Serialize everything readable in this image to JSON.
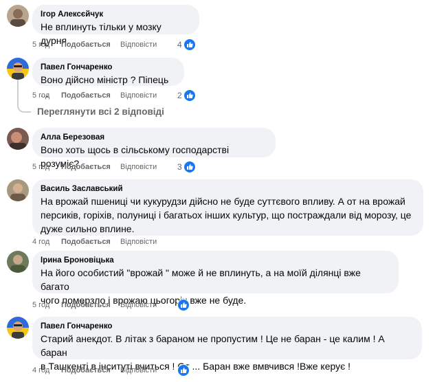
{
  "comments": [
    {
      "author": "Ігор Алексєйчук",
      "text": [
        "Не вплинуть тільки у мозку дурня."
      ],
      "time": "5 год",
      "like": "Подобається",
      "reply": "Відповісти",
      "reactions": "4"
    },
    {
      "author": "Павел Гончаренко",
      "text": [
        "Воно дійсно міністр ? Піпець ..."
      ],
      "time": "5 год",
      "like": "Подобається",
      "reply": "Відповісти",
      "reactions": "2"
    },
    {
      "author": "Алла Березовая",
      "text": [
        "Воно хоть щось в сільському господарстві розуміє?"
      ],
      "time": "5 год",
      "like": "Подобається",
      "reply": "Відповісти",
      "reactions": "3"
    },
    {
      "author": "Василь Заславський",
      "text": [
        "На врожай пшениці чи кукурудзи дійсно не буде суттєвого впливу. А от на врожай",
        "персиків, горіхів, полуниці і багатьох інших культур, що постраждали від морозу, це",
        "дуже сильно вплине."
      ],
      "time": "4 год",
      "like": "Подобається",
      "reply": "Відповісти",
      "reactions": ""
    },
    {
      "author": "Ірина Броновіцька",
      "text": [
        "На його особистий \"врожай \" може й не вплинуть, а на моїй ділянці вже багато",
        "чого померзло і врожаю цьогоріч вже не буде."
      ],
      "time": "5 год",
      "like": "Подобається",
      "reply": "Відповісти",
      "reactions": ""
    },
    {
      "author": "Павел Гончаренко",
      "text": [
        "Старий анекдот. В літак з бараном не пропустим ! Це не баран - це калим ! А баран",
        "в Ташкенті в інситуті вчиться ! От ... Баран вже вмвчився !Вже керує !"
      ],
      "time": "4 год",
      "like": "Подобається",
      "reply": "Відповісти",
      "reactions": ""
    }
  ],
  "view_all_replies": "Переглянути всі 2 відповіді",
  "colors": {
    "like_blue": "#1877f2",
    "bubble": "#f0f2f5",
    "meta": "#65676b"
  }
}
